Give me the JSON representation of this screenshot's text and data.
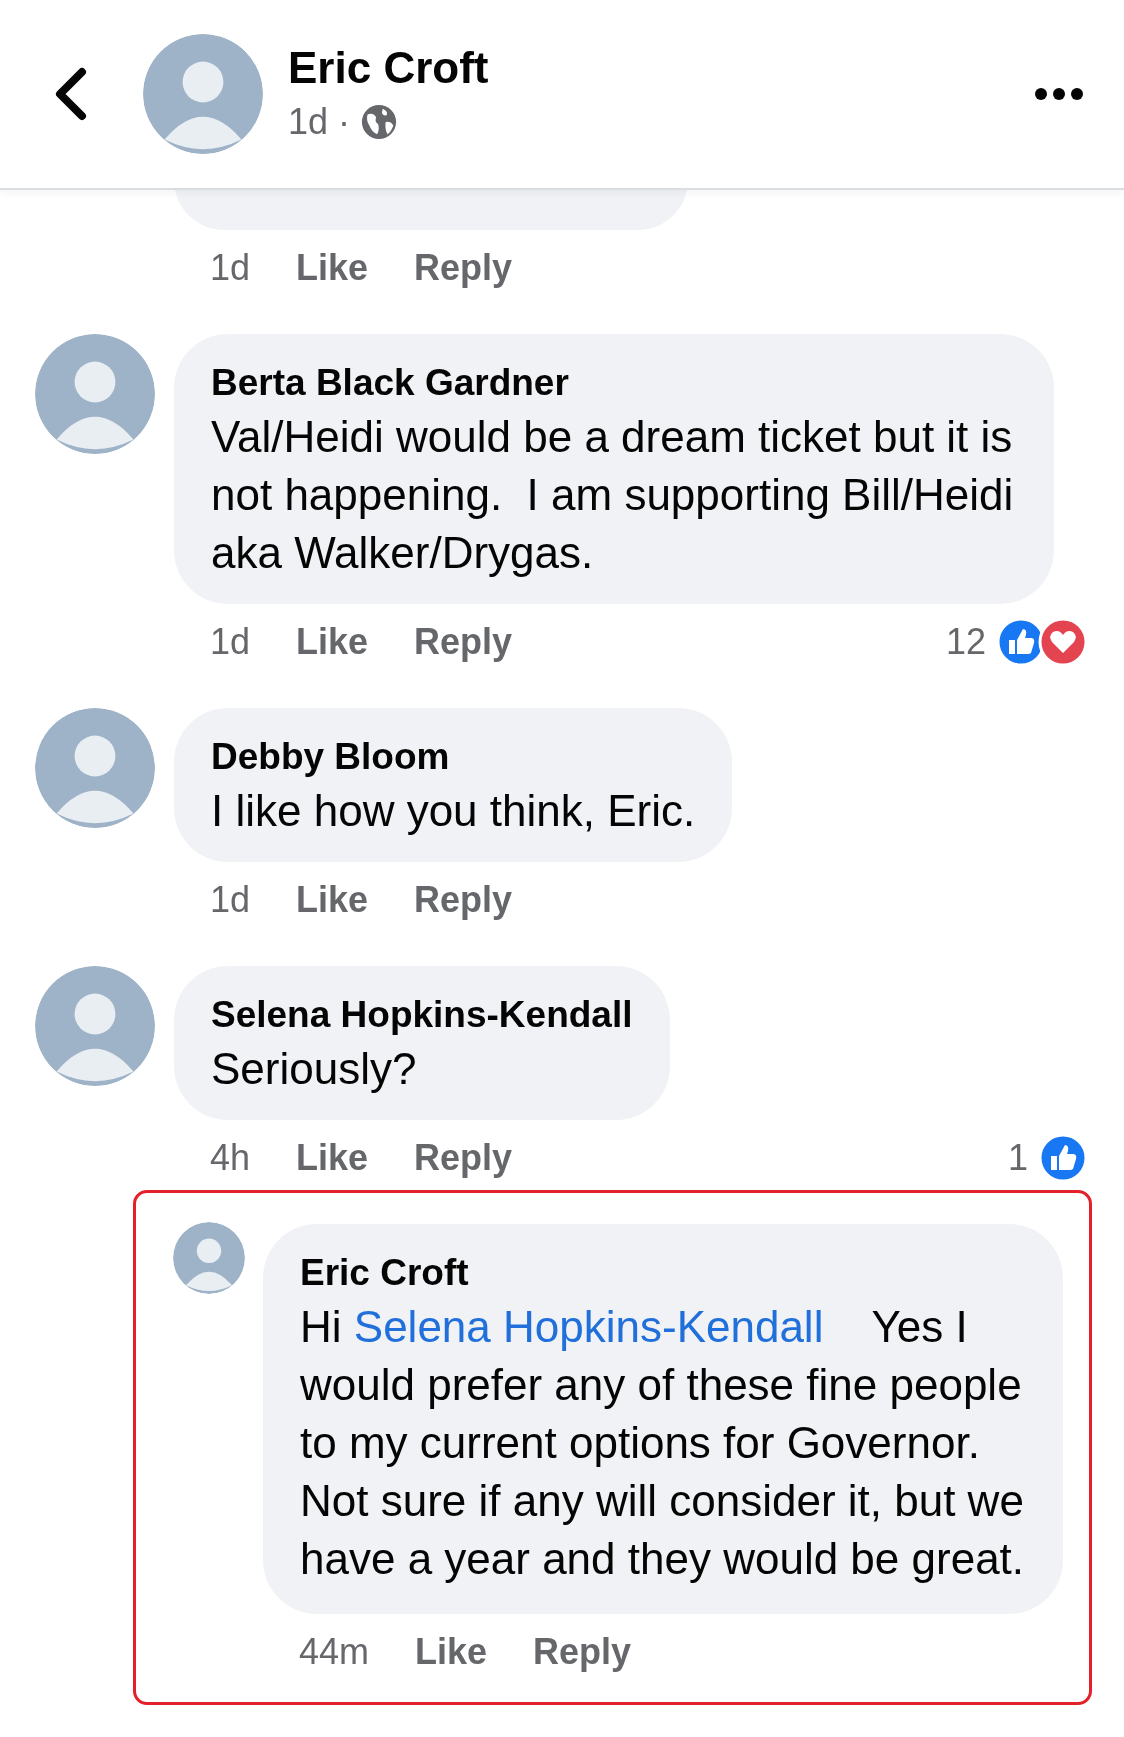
{
  "header": {
    "name": "Eric Croft",
    "time": "1d",
    "separator": "·"
  },
  "comments": [
    {
      "kind": "comment",
      "time": "1d",
      "like": "Like",
      "reply": "Reply"
    },
    {
      "kind": "comment",
      "name": "Berta Black Gardner",
      "text": "Val/Heidi would be a dream ticket but it is not happening.  I am supporting Bill/Heidi aka Walker/Drygas.",
      "time": "1d",
      "like": "Like",
      "reply": "Reply",
      "reaction_count": "12",
      "reactions": [
        {
          "kind": "like"
        },
        {
          "kind": "love"
        }
      ]
    },
    {
      "kind": "comment",
      "name": "Debby Bloom",
      "text": "I like how you think, Eric.",
      "time": "1d",
      "like": "Like",
      "reply": "Reply"
    },
    {
      "kind": "comment",
      "name": "Selena Hopkins-Kendall",
      "text": "Seriously?",
      "time": "4h",
      "like": "Like",
      "reply": "Reply",
      "reaction_count": "1",
      "reactions": [
        {
          "kind": "like"
        }
      ]
    },
    {
      "kind": "reply",
      "name": "Eric Croft",
      "parts": [
        {
          "kind": "text",
          "text": "Hi "
        },
        {
          "kind": "mention",
          "text": "Selena Hopkins-Kendall"
        },
        {
          "kind": "text",
          "text": "    Yes I would prefer any of these fine people to my current options for Governor.   Not sure if any will consider it, but we have a year and they would be great."
        }
      ],
      "time": "44m",
      "like": "Like",
      "reply": "Reply"
    }
  ]
}
